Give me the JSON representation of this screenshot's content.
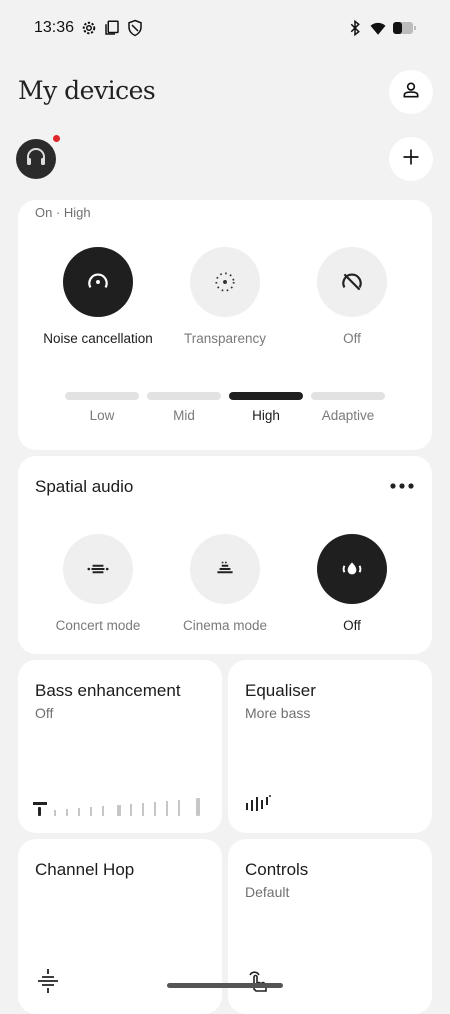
{
  "status_bar": {
    "time": "13:36",
    "left_icons": [
      "gear-icon",
      "copy-icon",
      "shield-icon"
    ],
    "right_icons": [
      "bluetooth-icon",
      "wifi-icon",
      "battery-icon"
    ]
  },
  "header": {
    "title": "My devices"
  },
  "device": {
    "icon": "headphones-icon",
    "has_notification": true
  },
  "noise": {
    "status": "On · High",
    "modes": [
      {
        "label": "Noise cancellation",
        "icon": "noise-cancel-icon",
        "active": true
      },
      {
        "label": "Transparency",
        "icon": "transparency-icon",
        "active": false
      },
      {
        "label": "Off",
        "icon": "off-icon",
        "active": false
      }
    ],
    "levels": [
      {
        "label": "Low",
        "active": false
      },
      {
        "label": "Mid",
        "active": false
      },
      {
        "label": "High",
        "active": true
      },
      {
        "label": "Adaptive",
        "active": false
      }
    ]
  },
  "spatial": {
    "title": "Spatial audio",
    "modes": [
      {
        "label": "Concert mode",
        "icon": "concert-icon",
        "active": false
      },
      {
        "label": "Cinema mode",
        "icon": "cinema-icon",
        "active": false
      },
      {
        "label": "Off",
        "icon": "spatial-off-icon",
        "active": true
      }
    ]
  },
  "tiles": [
    {
      "title": "Bass enhancement",
      "subtitle": "Off",
      "icon": "bass-level-icon"
    },
    {
      "title": "Equaliser",
      "subtitle": "More bass",
      "icon": "equaliser-icon"
    },
    {
      "title": "Channel Hop",
      "subtitle": "",
      "icon": "channel-hop-icon"
    },
    {
      "title": "Controls",
      "subtitle": "Default",
      "icon": "gesture-icon"
    }
  ],
  "colors": {
    "background": "#f2f2f2",
    "card": "#ffffff",
    "active": "#1f1f1f",
    "inactive": "#efefef",
    "notification": "#e0262b"
  }
}
